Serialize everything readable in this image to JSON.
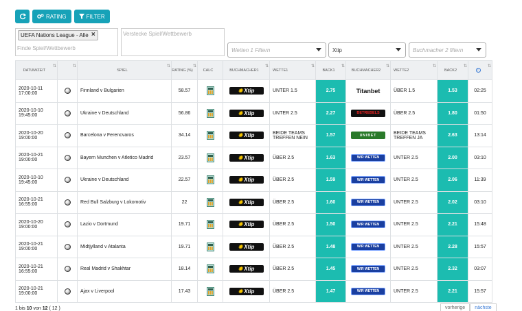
{
  "toolbar": {
    "refresh_icon": "refresh-icon",
    "rating_label": "RATING",
    "filter_label": "FILTER"
  },
  "filters": {
    "competition_tag": "UEFA Nations League - Alle",
    "find_placeholder": "Finde Spiel/Wettbewerb",
    "hide_placeholder": "Verstecke Spiel/Wettbewerb",
    "bet1_placeholder": "Wetten 1 Filtern",
    "bookmaker1_selected": "Xtip",
    "bookmaker2_placeholder": "Buchmacher 2 filtern"
  },
  "table": {
    "headers": {
      "datetime": "DATUM/ZEIT",
      "game": "SPIEL",
      "rating": "RATING (%)",
      "calc": "CALC",
      "bookmaker1": "BUCHMACHER1",
      "bet1": "WETTE1",
      "back1": "BACK1",
      "bookmaker2": "BUCHMACHER2",
      "bet2": "WETTE2",
      "back2": "BACK2"
    },
    "rows": [
      {
        "date": "2020-10-11",
        "time": "17:00:00",
        "game": "Finnland v Bulgarien",
        "rating": "58.57",
        "bm1": "Xtip",
        "bet1": "UNTER 1.5",
        "back1": "2.75",
        "bm2": "Titanbet",
        "bet2": "ÜBER 1.5",
        "back2": "1.53",
        "countdown": "02:25"
      },
      {
        "date": "2020-10-10",
        "time": "19:45:00",
        "game": "Ukraine v Deutschland",
        "rating": "56.86",
        "bm1": "Xtip",
        "bet1": "UNTER 2.5",
        "back1": "2.27",
        "bm2": "BETREBELS",
        "bet2": "ÜBER 2.5",
        "back2": "1.80",
        "countdown": "01:50"
      },
      {
        "date": "2020-10-20",
        "time": "19:00:00",
        "game": "Barcelona v Ferencvaros",
        "rating": "34.14",
        "bm1": "Xtip",
        "bet1": "BEIDE TEAMS TREFFEN NEIN",
        "back1": "1.57",
        "bm2": "UNIBET",
        "bet2": "BEIDE TEAMS TREFFEN JA",
        "back2": "2.63",
        "countdown": "13:14"
      },
      {
        "date": "2020-10-21",
        "time": "19:00:00",
        "game": "Bayern Munchen v Atletico Madrid",
        "rating": "23.57",
        "bm1": "Xtip",
        "bet1": "ÜBER 2.5",
        "back1": "1.63",
        "bm2": "WIR WETTEN",
        "bet2": "UNTER 2.5",
        "back2": "2.00",
        "countdown": "03:10"
      },
      {
        "date": "2020-10-10",
        "time": "19:45:00",
        "game": "Ukraine v Deutschland",
        "rating": "22.57",
        "bm1": "Xtip",
        "bet1": "ÜBER 2.5",
        "back1": "1.59",
        "bm2": "WIR WETTEN",
        "bet2": "UNTER 2.5",
        "back2": "2.06",
        "countdown": "11:39"
      },
      {
        "date": "2020-10-21",
        "time": "16:55:00",
        "game": "Red Bull Salzburg v Lokomotiv",
        "rating": "22",
        "bm1": "Xtip",
        "bet1": "ÜBER 2.5",
        "back1": "1.60",
        "bm2": "WIR WETTEN",
        "bet2": "UNTER 2.5",
        "back2": "2.02",
        "countdown": "03:10"
      },
      {
        "date": "2020-10-20",
        "time": "19:00:00",
        "game": "Lazio v Dortmund",
        "rating": "19.71",
        "bm1": "Xtip",
        "bet1": "ÜBER 2.5",
        "back1": "1.50",
        "bm2": "WIR WETTEN",
        "bet2": "UNTER 2.5",
        "back2": "2.21",
        "countdown": "15:48"
      },
      {
        "date": "2020-10-21",
        "time": "19:00:00",
        "game": "Midtjylland v Atalanta",
        "rating": "19.71",
        "bm1": "Xtip",
        "bet1": "ÜBER 2.5",
        "back1": "1.48",
        "bm2": "WIR WETTEN",
        "bet2": "UNTER 2.5",
        "back2": "2.28",
        "countdown": "15:57"
      },
      {
        "date": "2020-10-21",
        "time": "16:55:00",
        "game": "Real Madrid v Shakhtar",
        "rating": "18.14",
        "bm1": "Xtip",
        "bet1": "ÜBER 2.5",
        "back1": "1.45",
        "bm2": "WIR WETTEN",
        "bet2": "UNTER 2.5",
        "back2": "2.32",
        "countdown": "03:07"
      },
      {
        "date": "2020-10-21",
        "time": "19:00:00",
        "game": "Ajax v Liverpool",
        "rating": "17.43",
        "bm1": "Xtip",
        "bet1": "ÜBER 2.5",
        "back1": "1.47",
        "bm2": "WIR WETTEN",
        "bet2": "UNTER 2.5",
        "back2": "2.21",
        "countdown": "15:57"
      }
    ]
  },
  "footer": {
    "info_prefix": "1 bis ",
    "info_to": "10",
    "info_of_label": " von ",
    "info_total": "12",
    "info_suffix": " ( 12 )",
    "prev_label": "vorherige",
    "next_label": "nächste"
  },
  "colors": {
    "accent": "#17a2b8",
    "back_cell": "#1cbcb0"
  }
}
